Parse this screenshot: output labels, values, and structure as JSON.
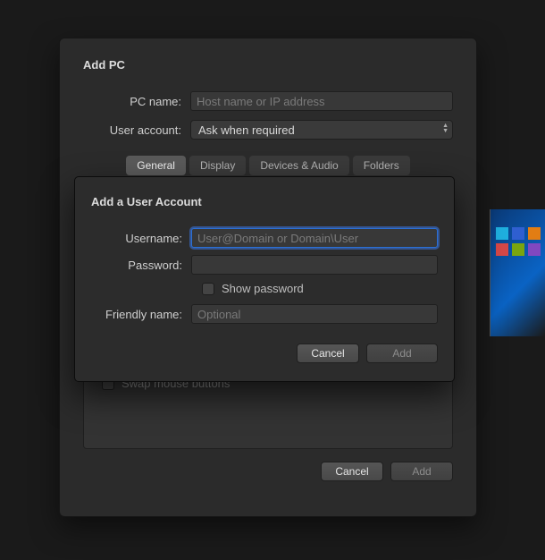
{
  "addpc": {
    "title": "Add PC",
    "fields": {
      "pc_name_label": "PC name:",
      "pc_name_placeholder": "Host name or IP address",
      "user_account_label": "User account:",
      "user_account_value": "Ask when required"
    },
    "tabs": [
      "General",
      "Display",
      "Devices & Audio",
      "Folders"
    ],
    "active_tab": "General",
    "swap_mouse_label": "Swap mouse buttons",
    "buttons": {
      "cancel": "Cancel",
      "add": "Add"
    }
  },
  "user_modal": {
    "title": "Add a User Account",
    "username_label": "Username:",
    "username_value": "",
    "username_placeholder": "User@Domain or Domain\\User",
    "password_label": "Password:",
    "password_value": "",
    "show_password_label": "Show password",
    "friendly_label": "Friendly name:",
    "friendly_value": "",
    "friendly_placeholder": "Optional",
    "buttons": {
      "cancel": "Cancel",
      "add": "Add"
    }
  }
}
